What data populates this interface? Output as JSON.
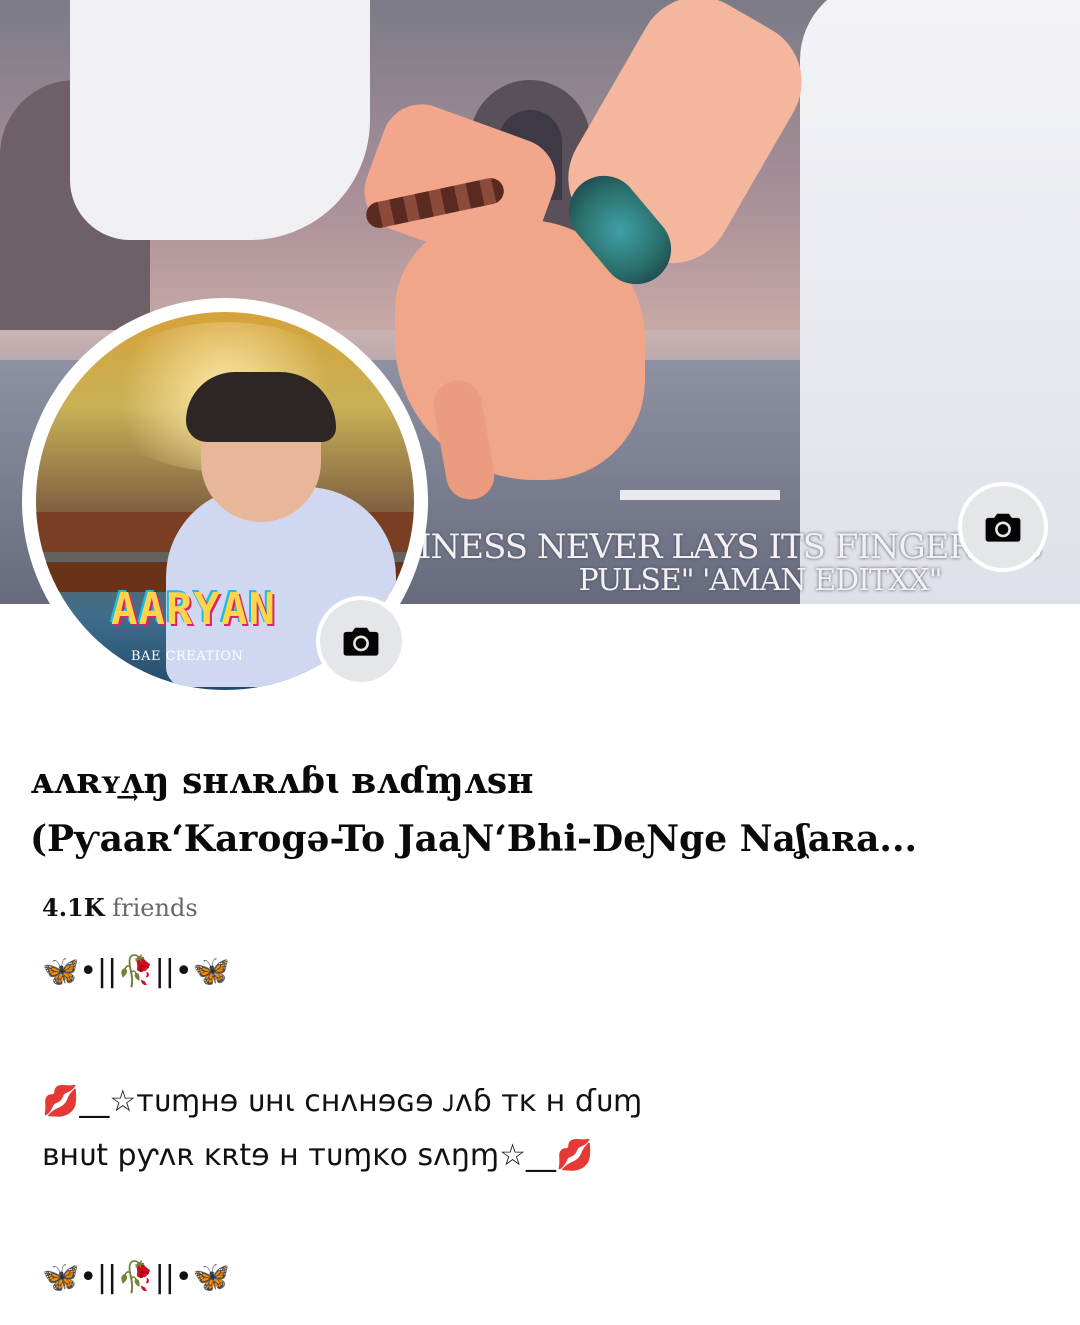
{
  "cover": {
    "caption_line1": "INESS NEVER LAYS ITS FINGER O  S",
    "caption_line2": "PULSE\"   'AMAN EDITXX\""
  },
  "avatar": {
    "logo_text": "AARYAN",
    "small_text": "BAE CREATION"
  },
  "profile": {
    "name_line1": "ᴀᴧʀʏ͢ᴧŋ ꜱʜᴧʀᴧɓɩ ʙᴧɗɱᴧsʜ",
    "name_line2": "(Pƴaaʀ‘Karogə-To JaaƝ‘Bhi-DeƝge Naʆaʀa...",
    "friends_count": "4.1K",
    "friends_label": "friends"
  },
  "bio": {
    "line1": "🦋•||🥀||•🦋",
    "line2": "💋__☆ᴛᴜɱʜɘ ᴜʜɩ ᴄʜᴧʜɘɢɘ ᴊᴧɓ ᴛᴋ ʜ ɗᴜɱ",
    "line3": "ʙʜᴜt pƴᴧʀ ᴋʀtɘ ʜ ᴛᴜɱᴋo ꜱᴧŋɱ☆__💋",
    "line4": "🦋•||🥀||•🦋"
  },
  "icons": {
    "cover_camera": "camera-icon",
    "avatar_camera": "camera-icon"
  }
}
